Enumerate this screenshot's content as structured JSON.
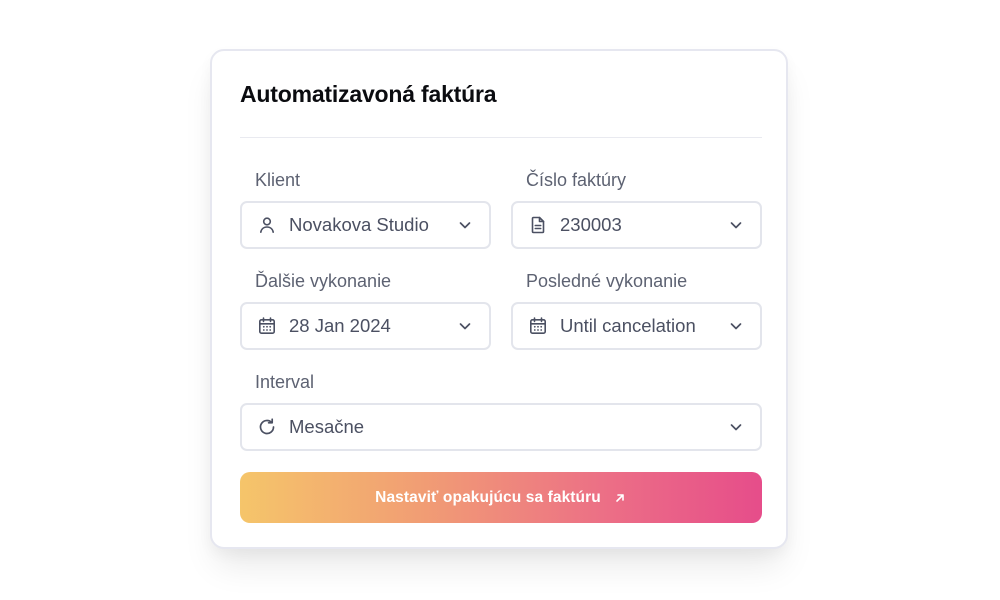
{
  "card": {
    "title": "Automatizavoná faktúra"
  },
  "form": {
    "client": {
      "label": "Klient",
      "value": "Novakova Studio",
      "icon": "user-icon"
    },
    "invoice_number": {
      "label": "Číslo faktúry",
      "value": "230003",
      "icon": "document-icon"
    },
    "next_run": {
      "label": "Ďalšie vykonanie",
      "value": "28 Jan 2024",
      "icon": "calendar-icon"
    },
    "last_run": {
      "label": "Posledné vykonanie",
      "value": "Until cancelation",
      "icon": "calendar-icon"
    },
    "interval": {
      "label": "Interval",
      "value": "Mesačne",
      "icon": "refresh-icon"
    }
  },
  "cta": {
    "label": "Nastaviť opakujúcu sa faktúru",
    "icon": "arrow-up-right-icon"
  },
  "colors": {
    "label_text": "#5d6272",
    "value_text": "#4b5062",
    "border": "#e3e5ec",
    "gradient_start": "#f5c56a",
    "gradient_end": "#e64d8a"
  }
}
